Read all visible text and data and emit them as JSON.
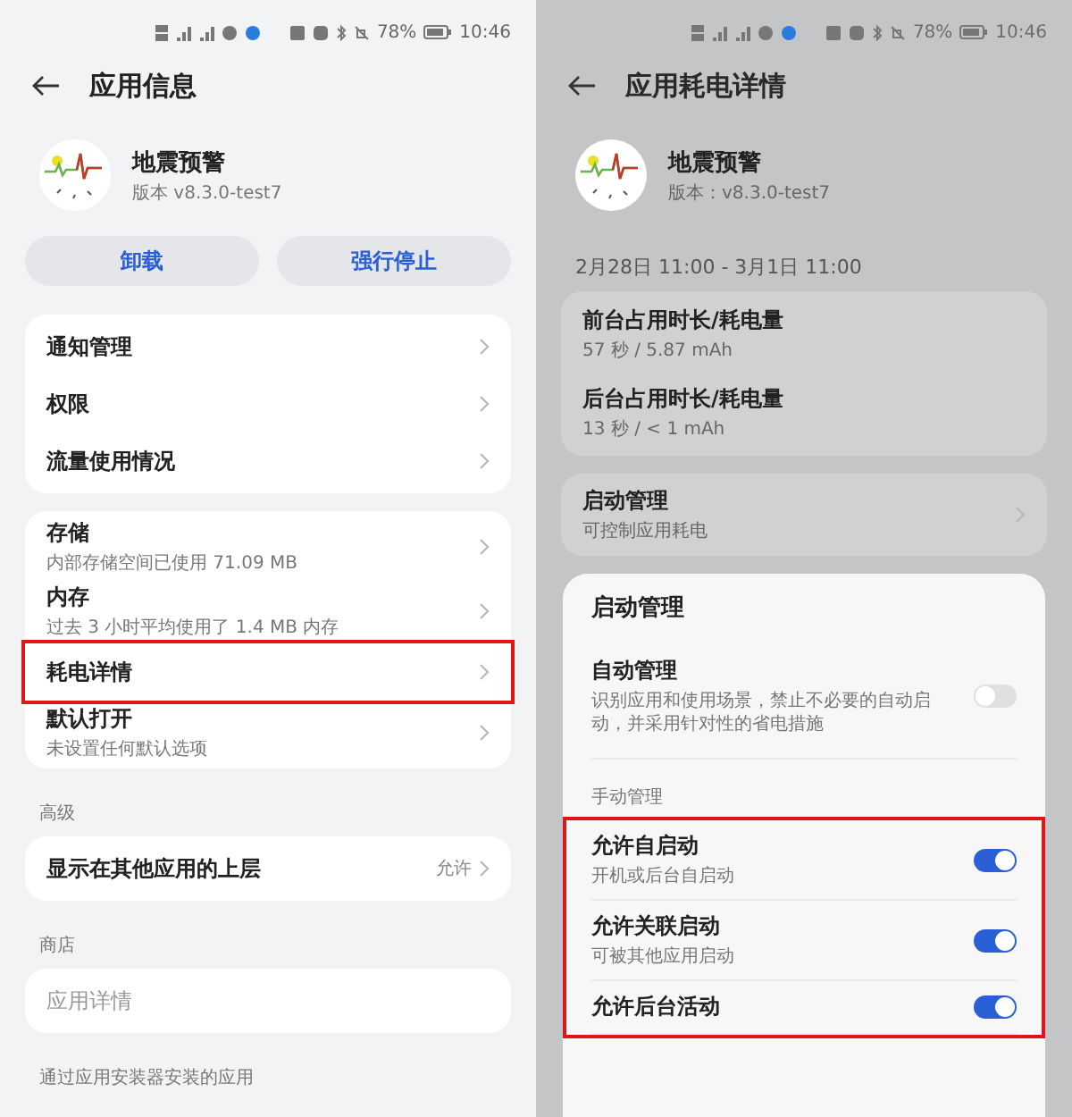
{
  "left": {
    "status_bar": {
      "battery": "78%",
      "time": "10:46"
    },
    "title": "应用信息",
    "app": {
      "name": "地震预警",
      "version": "版本 v8.3.0-test7"
    },
    "buttons": [
      "卸载",
      "强行停止"
    ],
    "groups": [
      {
        "items": [
          {
            "title": "通知管理",
            "highlighted": false
          },
          {
            "title": "权限",
            "highlighted": false
          },
          {
            "title": "流量使用情况",
            "highlighted": false
          }
        ]
      },
      {
        "items": [
          {
            "title": "存储",
            "subtitle": "内部存储空间已使用 71.09 MB",
            "highlighted": false
          },
          {
            "title": "内存",
            "subtitle": "过去 3 小时平均使用了 1.4 MB 内存",
            "highlighted": false
          },
          {
            "title": "耗电详情",
            "highlighted": true
          },
          {
            "title": "默认打开",
            "subtitle": "未设置任何默认选项",
            "highlighted": false
          }
        ]
      },
      {
        "label": "高级",
        "items": [
          {
            "title": "显示在其他应用的上层",
            "value": "允许",
            "highlighted": false
          }
        ]
      },
      {
        "label": "商店",
        "items": [
          {
            "title": "应用详情",
            "disabled": true,
            "chevron": false,
            "highlighted": false
          }
        ]
      }
    ],
    "footnote": "通过应用安装器安装的应用"
  },
  "right": {
    "status_bar": {
      "battery": "78%",
      "time": "10:46"
    },
    "title": "应用耗电详情",
    "app": {
      "name": "地震预警",
      "version": "版本：v8.3.0-test7"
    },
    "period": "2月28日 11:00 - 3月1日 11:00",
    "usage": [
      {
        "title": "前台占用时长/耗电量",
        "subtitle": "57 秒 / 5.87 mAh"
      },
      {
        "title": "后台占用时长/耗电量",
        "subtitle": "13 秒 / < 1 mAh"
      }
    ],
    "launch": {
      "title": "启动管理",
      "subtitle": "可控制应用耗电"
    },
    "sheet": {
      "title": "启动管理",
      "auto": {
        "title": "自动管理",
        "subtitle": "识别应用和使用场景，禁止不必要的自动启动，并采用针对性的省电措施",
        "on": false
      },
      "manual_label": "手动管理",
      "manual_highlighted": true,
      "manual": [
        {
          "title": "允许自启动",
          "subtitle": "开机或后台自启动",
          "on": true
        },
        {
          "title": "允许关联启动",
          "subtitle": "可被其他应用启动",
          "on": true
        },
        {
          "title": "允许后台活动",
          "on": true
        }
      ]
    }
  }
}
